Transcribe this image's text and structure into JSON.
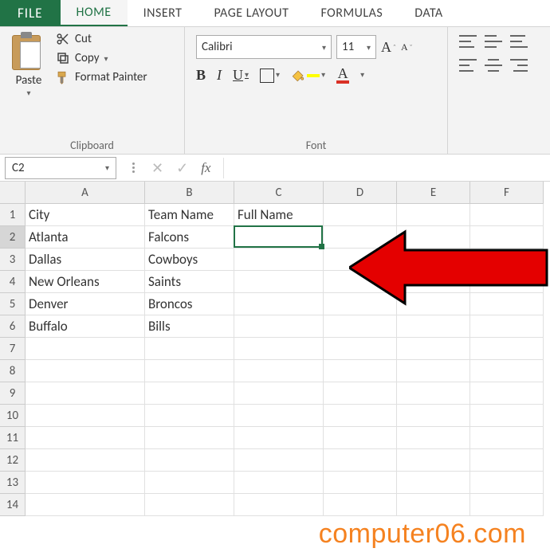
{
  "tabs": {
    "file": "FILE",
    "list": [
      "HOME",
      "INSERT",
      "PAGE LAYOUT",
      "FORMULAS",
      "DATA"
    ],
    "active_index": 0
  },
  "ribbon": {
    "clipboard": {
      "paste": "Paste",
      "cut": "Cut",
      "copy": "Copy",
      "format_painter": "Format Painter",
      "group_label": "Clipboard"
    },
    "font": {
      "name": "Calibri",
      "size": "11",
      "bold": "B",
      "italic": "I",
      "underline": "U",
      "group_label": "Font"
    }
  },
  "namebox": "C2",
  "fx_label": "fx",
  "grid": {
    "col_widths": {
      "A": 150,
      "B": 112,
      "C": 112,
      "D": 92,
      "E": 92,
      "F": 92
    },
    "columns": [
      "A",
      "B",
      "C",
      "D",
      "E",
      "F"
    ],
    "row_count": 14,
    "data": {
      "A1": "City",
      "B1": "Team Name",
      "C1": "Full Name",
      "A2": "Atlanta",
      "B2": "Falcons",
      "A3": "Dallas",
      "B3": "Cowboys",
      "A4": "New Orleans",
      "B4": "Saints",
      "A5": "Denver",
      "B5": "Broncos",
      "A6": "Buffalo",
      "B6": "Bills"
    },
    "selected": "C2"
  },
  "watermark": "computer06.com"
}
